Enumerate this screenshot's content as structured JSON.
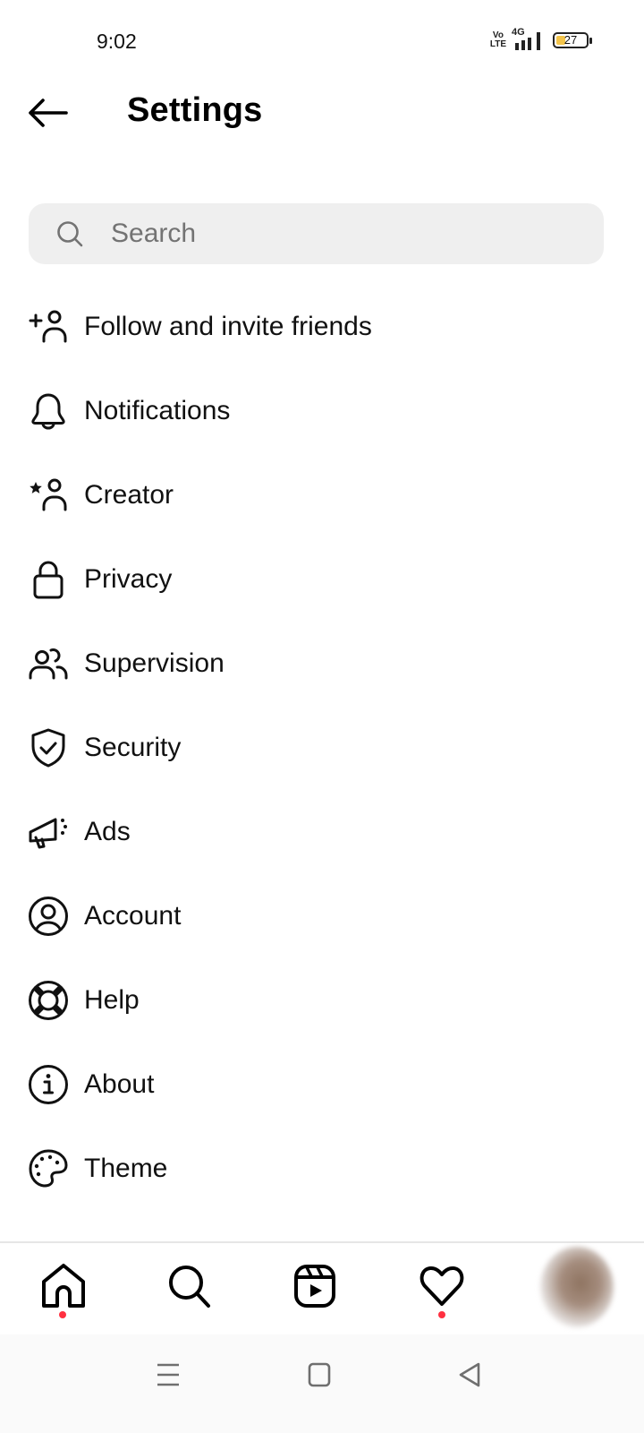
{
  "status_bar": {
    "time": "9:02",
    "volte_line1": "Vo",
    "volte_line2": "LTE",
    "network": "4G",
    "battery_percent": "27"
  },
  "header": {
    "title": "Settings",
    "back_icon": "arrow-left-icon"
  },
  "search": {
    "placeholder": "Search",
    "value": "",
    "icon": "search-icon"
  },
  "menu": {
    "items": [
      {
        "label": "Follow and invite friends",
        "icon": "add-person-icon"
      },
      {
        "label": "Notifications",
        "icon": "bell-icon"
      },
      {
        "label": "Creator",
        "icon": "star-person-icon"
      },
      {
        "label": "Privacy",
        "icon": "lock-icon"
      },
      {
        "label": "Supervision",
        "icon": "people-icon"
      },
      {
        "label": "Security",
        "icon": "shield-check-icon"
      },
      {
        "label": "Ads",
        "icon": "megaphone-icon"
      },
      {
        "label": "Account",
        "icon": "account-circle-icon"
      },
      {
        "label": "Help",
        "icon": "lifebuoy-icon"
      },
      {
        "label": "About",
        "icon": "info-icon"
      },
      {
        "label": "Theme",
        "icon": "palette-icon"
      }
    ]
  },
  "tab_bar": {
    "tabs": [
      {
        "name": "home",
        "icon": "home-icon",
        "has_notification_dot": true
      },
      {
        "name": "search",
        "icon": "search-icon",
        "has_notification_dot": false
      },
      {
        "name": "reels",
        "icon": "reels-icon",
        "has_notification_dot": false
      },
      {
        "name": "activity",
        "icon": "heart-icon",
        "has_notification_dot": true
      },
      {
        "name": "profile",
        "icon": "avatar",
        "has_notification_dot": false
      }
    ],
    "notification_dot_color": "#ff3040"
  },
  "system_nav": {
    "buttons": [
      "recents",
      "home",
      "back"
    ]
  }
}
